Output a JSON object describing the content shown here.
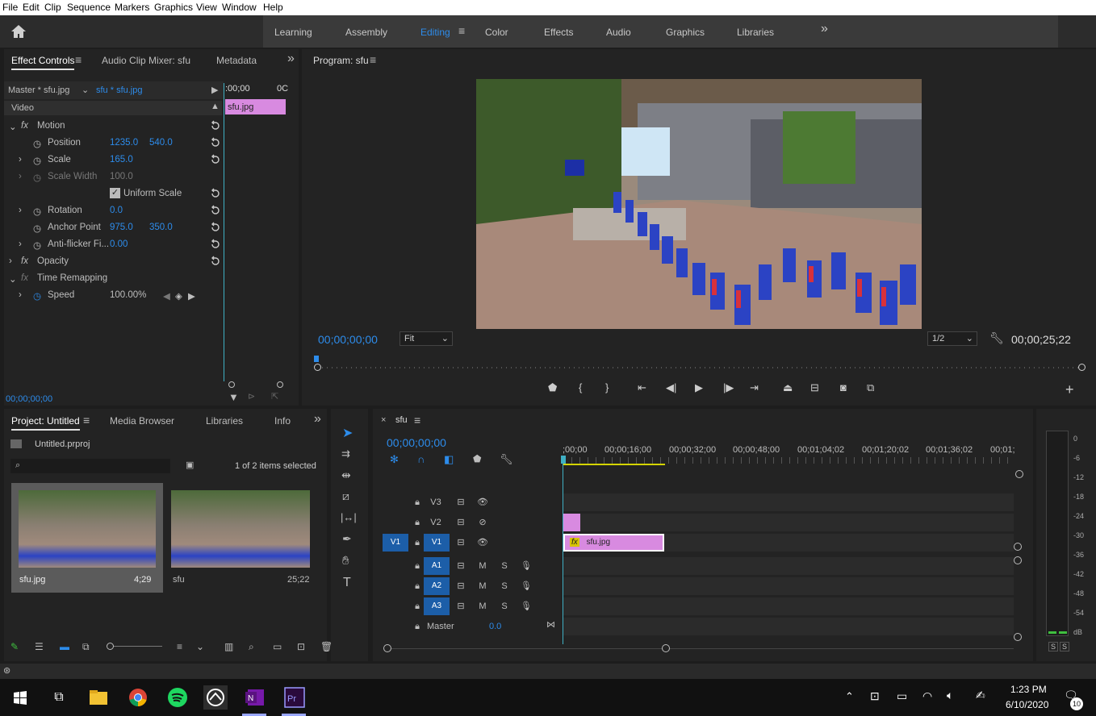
{
  "menu": [
    "File",
    "Edit",
    "Clip",
    "Sequence",
    "Markers",
    "Graphics",
    "View",
    "Window",
    "Help"
  ],
  "workspaces": [
    "Learning",
    "Assembly",
    "Editing",
    "Color",
    "Effects",
    "Audio",
    "Graphics",
    "Libraries"
  ],
  "active_workspace": "Editing",
  "effect_controls": {
    "tabs": [
      "Effect Controls",
      "Audio Clip Mixer: sfu",
      "Metadata"
    ],
    "master": "Master * sfu.jpg",
    "clip": "sfu * sfu.jpg",
    "ruler_start": ":00;00",
    "ruler_end": "0C",
    "clip_label": "sfu.jpg",
    "section": "Video",
    "motion": "Motion",
    "position_label": "Position",
    "position_x": "1235.0",
    "position_y": "540.0",
    "scale_label": "Scale",
    "scale_val": "165.0",
    "scale_width_label": "Scale Width",
    "scale_width_val": "100.0",
    "uniform_label": "Uniform Scale",
    "rotation_label": "Rotation",
    "rotation_val": "0.0",
    "anchor_label": "Anchor Point",
    "anchor_x": "975.0",
    "anchor_y": "350.0",
    "antiflicker_label": "Anti-flicker Fi...",
    "antiflicker_val": "0.00",
    "opacity": "Opacity",
    "time_remap": "Time Remapping",
    "speed_label": "Speed",
    "speed_val": "100.00%",
    "timecode": "00;00;00;00"
  },
  "program": {
    "title": "Program: sfu",
    "timecode_left": "00;00;00;00",
    "fit": "Fit",
    "resolution": "1/2",
    "timecode_right": "00;00;25;22"
  },
  "project": {
    "tabs": [
      "Project: Untitled",
      "Media Browser",
      "Libraries",
      "Info"
    ],
    "file": "Untitled.prproj",
    "selected": "1 of 2 items selected",
    "items": [
      {
        "name": "sfu.jpg",
        "duration": "4;29"
      },
      {
        "name": "sfu",
        "duration": "25;22"
      }
    ]
  },
  "timeline": {
    "seq": "sfu",
    "timecode": "00;00;00;00",
    "ruler": [
      ";00;00",
      "00;00;16;00",
      "00;00;32;00",
      "00;00;48;00",
      "00;01;04;02",
      "00;01;20;02",
      "00;01;36;02",
      "00;01;"
    ],
    "video_tracks": [
      "V3",
      "V2",
      "V1"
    ],
    "src_v": "V1",
    "audio_tracks": [
      "A1",
      "A2",
      "A3"
    ],
    "m": "M",
    "s": "S",
    "master": "Master",
    "master_val": "0.0",
    "clip": "sfu.jpg",
    "fx": "fx"
  },
  "meter": {
    "ticks": [
      "0",
      "-6",
      "-12",
      "-18",
      "-24",
      "-30",
      "-36",
      "-42",
      "-48",
      "-54",
      "dB"
    ],
    "solo": [
      "S",
      "S"
    ]
  },
  "taskbar": {
    "time": "1:23 PM",
    "date": "6/10/2020",
    "notifications": "10"
  }
}
